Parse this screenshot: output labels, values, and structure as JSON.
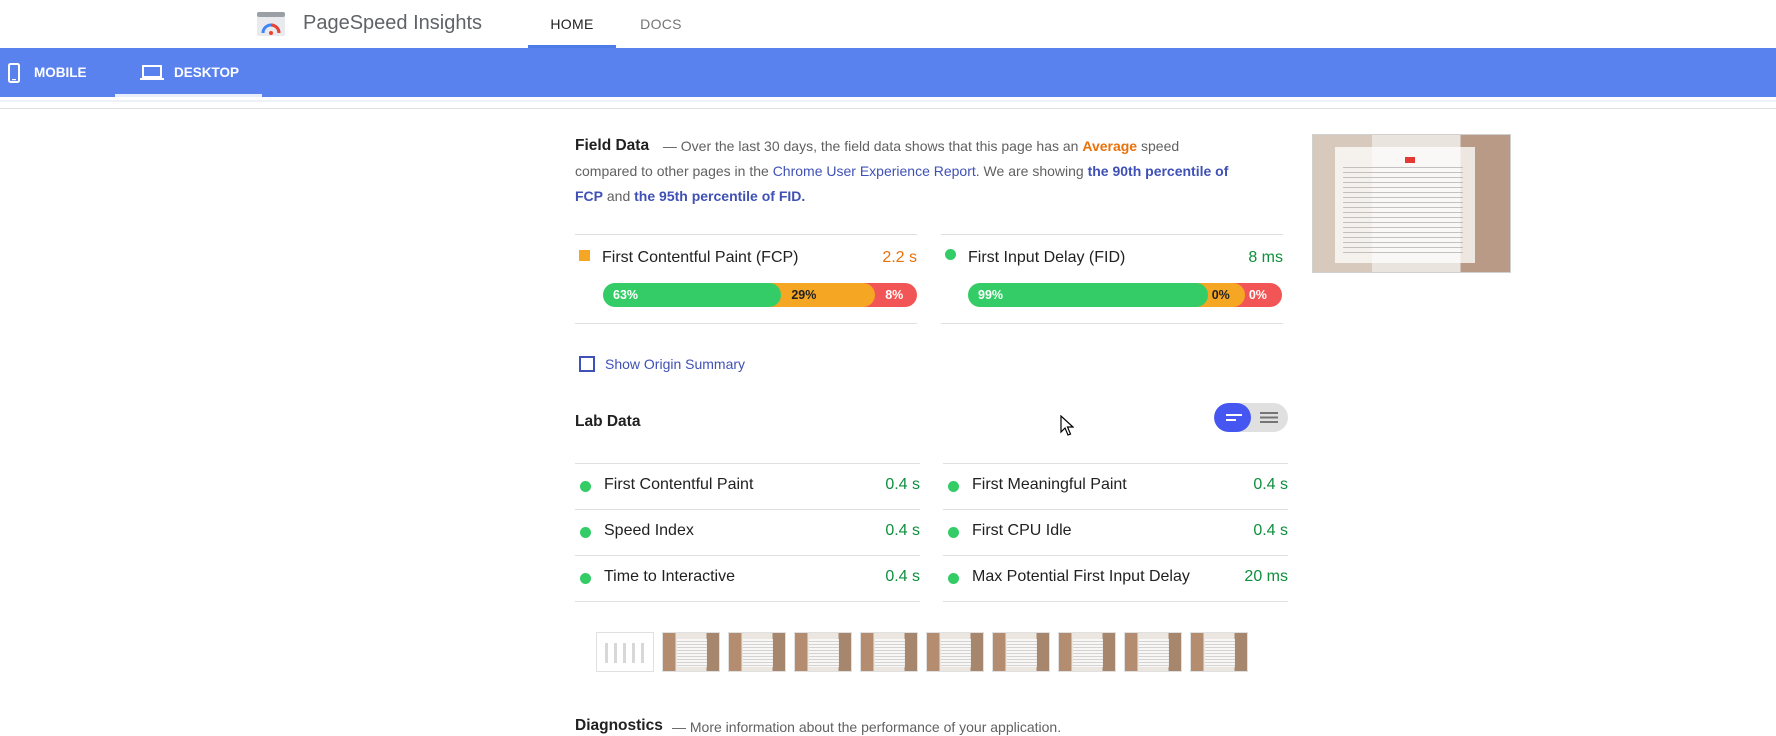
{
  "header": {
    "app_title": "PageSpeed Insights",
    "tabs": [
      {
        "label": "HOME",
        "active": true
      },
      {
        "label": "DOCS",
        "active": false
      }
    ]
  },
  "device_tabs": [
    {
      "label": "MOBILE",
      "icon": "smartphone-icon",
      "active": false
    },
    {
      "label": "DESKTOP",
      "icon": "laptop-icon",
      "active": true
    }
  ],
  "field_data": {
    "title": "Field Data",
    "text_1": "— Over the last 30 days, the field data shows that this page has an",
    "rating": "Average",
    "text_2": "speed compared to other pages in the",
    "report_link": "Chrome User Experience Report",
    "text_3": ". We are showing",
    "percentile_fcp_link": "the 90th percentile of FCP",
    "text_4": "and",
    "percentile_fid_link": "the 95th percentile of FID",
    "text_5": ".",
    "metrics": [
      {
        "label": "First Contentful Paint (FCP)",
        "value": "2.2 s",
        "status": "average",
        "distribution": {
          "fast": "63%",
          "average": "29%",
          "slow": "8%"
        },
        "fractions": {
          "fast": 0.63,
          "average": 0.29,
          "slow": 0.08
        }
      },
      {
        "label": "First Input Delay (FID)",
        "value": "8 ms",
        "status": "fast",
        "distribution": {
          "fast": "99%",
          "average": "0%",
          "slow": "0%"
        },
        "fractions": {
          "fast": 0.99,
          "average": 0.0,
          "slow": 0.0
        }
      }
    ],
    "show_origin_summary": "Show Origin Summary"
  },
  "lab_data": {
    "title": "Lab Data",
    "left": [
      {
        "label": "First Contentful Paint",
        "value": "0.4 s"
      },
      {
        "label": "Speed Index",
        "value": "0.4 s"
      },
      {
        "label": "Time to Interactive",
        "value": "0.4 s"
      }
    ],
    "right": [
      {
        "label": "First Meaningful Paint",
        "value": "0.4 s"
      },
      {
        "label": "First CPU Idle",
        "value": "0.4 s"
      },
      {
        "label": "Max Potential First Input Delay",
        "value": "20 ms"
      }
    ]
  },
  "diagnostics": {
    "title": "Diagnostics",
    "subtitle": "— More information about the performance of your application."
  },
  "colors": {
    "brand_blue": "#5a82ef",
    "fast": "#33cc66",
    "average": "#f5a623",
    "slow": "#f25555",
    "average_text": "#e8710a",
    "fast_text": "#0d8f3c",
    "link": "#3f51b5"
  }
}
